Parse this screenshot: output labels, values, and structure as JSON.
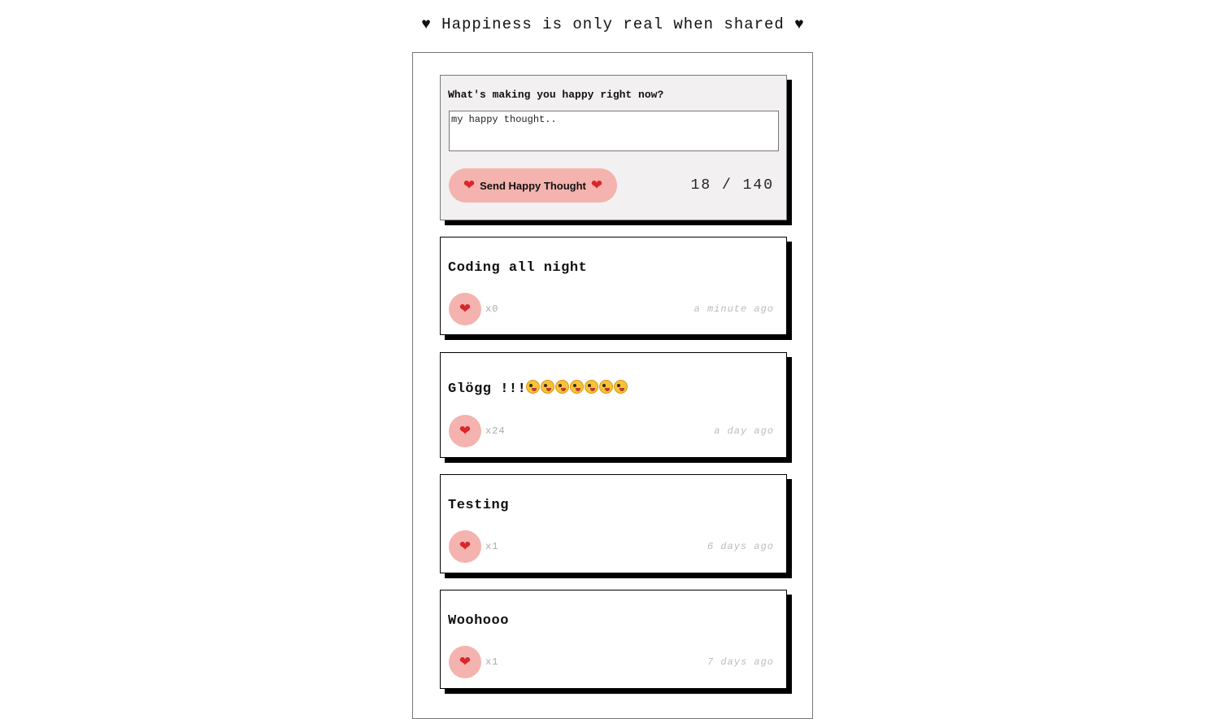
{
  "header": {
    "title": "♥ Happiness is only real when shared ♥"
  },
  "form": {
    "label": "What's making you happy right now?",
    "input_value": "my happy thought..",
    "send_label": "Send Happy Thought",
    "char_count": "18 / 140"
  },
  "thoughts": [
    {
      "message": "Coding all night",
      "likes": "x0",
      "time": "a minute ago"
    },
    {
      "message": "Glögg !!!",
      "emoji_count": 7,
      "emoji_icon": "zany-face-icon",
      "likes": "x24",
      "time": "a day ago"
    },
    {
      "message": "Testing",
      "likes": "x1",
      "time": "6 days ago"
    },
    {
      "message": "Woohooo",
      "likes": "x1",
      "time": "7 days ago"
    }
  ],
  "colors": {
    "accent_pink": "#f4b3ae",
    "heart_red": "#d9262b",
    "shadow": "#000000",
    "form_bg": "#f2f0f0"
  }
}
